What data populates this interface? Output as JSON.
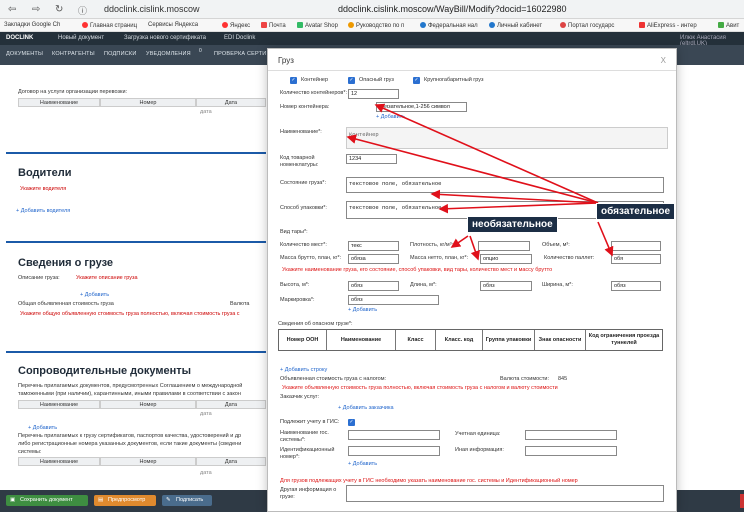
{
  "browser": {
    "url_domain": "ddoclink.cislink.moscow",
    "url_full": "ddoclink.cislink.moscow/WayBill/Modify?docid=16022980",
    "bookmarks": [
      "Закладки Google Ch",
      "Главная страниц",
      "Сервисы Яндекса",
      "Яндекс",
      "Почта",
      "Avatar Shop",
      "Руководство по п",
      "Федеральная нал",
      "Личный кабинет",
      "Портал государс",
      "AliExpress - интер",
      "Авит"
    ]
  },
  "app": {
    "logo": "DOCLINK",
    "header_items": [
      "Новый документ",
      "Загрузка нового сертификата",
      "EDI Doclink"
    ],
    "user": "Илюк Анастасия (eltrdl.UK)",
    "tabs": [
      "ДОКУМЕНТЫ",
      "КОНТРАГЕНТЫ",
      "ПОДПИСКИ",
      "УВЕДОМЛЕНИЯ",
      "ПРОВЕРКА СЕРТИ"
    ],
    "notif_count": "0"
  },
  "background": {
    "contract_label": "Договор на услуги организации перевозки:",
    "table_cols": [
      "Наименование",
      "Номер",
      "Дата"
    ],
    "date_word": "дата",
    "drivers_title": "Водители",
    "drivers_required": "Укажите водителя",
    "add_driver": "Добавить водителя",
    "cargo_title": "Сведения о грузе",
    "cargo_desc_label": "Описание груза:",
    "cargo_desc_required": "Укажите описание груза",
    "add": "Добавить",
    "declared_value": "Общая объявленная стоимость груза",
    "currency_label": "Валюта",
    "value_required": "Укажите общую объявленную стоимость груза полностью, включая стоимость груза с",
    "docs_title": "Сопроводительные документы",
    "docs_text1": "Перечень прилагаемых документов, предусмотренных Соглашением о международной",
    "docs_text2": "таможенными (при наличии), карантинными, иными правилами в соответствии с закон",
    "docs_text3": "Перечень прилагаемых к грузу сертификатов, паспортов качества, удостоверений и др",
    "docs_text4": "либо регистрационные номера указанных документов, если такие документы (сведени",
    "docs_text5": "системы:"
  },
  "footer": {
    "save": "Сохранить документ",
    "preview": "Предпросмотр",
    "sign": "Подписать"
  },
  "modal": {
    "title": "Груз",
    "close": "X",
    "checkboxes": [
      "Контейнер",
      "Опасный груз",
      "Крупногабаритный груз"
    ],
    "container_count_label": "Количество контейнеров*:",
    "container_count_value": "12",
    "container_number_label": "Номер контейнера:",
    "container_number_value": "обязательное,1-256 символ",
    "add": "Добавить",
    "name_label": "Наименование*:",
    "name_value": "Контейнер",
    "code_label": "Код товарной номенклатуры:",
    "code_value": "1234",
    "state_label": "Состояние груза*:",
    "state_value": "текстовое поле, обязательное",
    "packing_label": "Способ упаковки*:",
    "packing_value": "текстовое поле, обязательное",
    "tare_label": "Вид тары*:",
    "places_label": "Количество мест*:",
    "places_value": "текс",
    "density_label": "Плотность, кг/м³:",
    "volume_label": "Объем, м³:",
    "gross_label": "Масса брутто, план, кг*:",
    "gross_value": "обяза",
    "net_label": "Масса нетто, план, кг*:",
    "net_value": "опцио",
    "pallets_label": "Количество паллет:",
    "pallets_value": "обя",
    "error_packing": "Укажите наименование груза, его состояние, способ упаковки, вид тары, количество мест и массу брутто",
    "height_label": "Высота, м*:",
    "height_value": "обяз",
    "length_label": "Длина, м*:",
    "length_value": "обяз",
    "width_label": "Ширина, м*:",
    "width_value": "обяз",
    "marking_label": "Маркировка*:",
    "marking_value": "обяз",
    "dangerous_label": "Сведения об опасном грузе*:",
    "danger_cols": [
      "Номер ООН",
      "Наименование",
      "Класс",
      "Класс. код",
      "Группа упаковки",
      "Знак опасности",
      "Код ограничения проезда туннелей"
    ],
    "add_row": "Добавить строку",
    "declared_label": "Объявленная стоимость груза с налогом:",
    "currency_label": "Валюта стоимости:",
    "currency_value": "845",
    "error_value": "Укажите объявленную стоимость груза полностью, включая стоимость груза с налогом и валюту стоимости",
    "customer_label": "Заказчик услуг:",
    "add_customer": "Добавить заказчика",
    "gis_label": "Подлежит учету в ГИС:",
    "gis_name_label": "Наименование гос. системы*:",
    "unit_label": "Учетная единица:",
    "ident_label": "Идентификационный номер*:",
    "other_info_label": "Иная информация:",
    "error_gis": "Для грузов подлежащих учету в ГИС необходимо указать наименование гос. системы и Идентификационный номер",
    "other_cargo_label": "Другая информация о грузе:"
  },
  "annotations": {
    "required": "обязательное",
    "optional": "необязательное",
    "colors": {
      "arrow": "#e0101a",
      "callout_bg": "#1c2e45"
    }
  }
}
